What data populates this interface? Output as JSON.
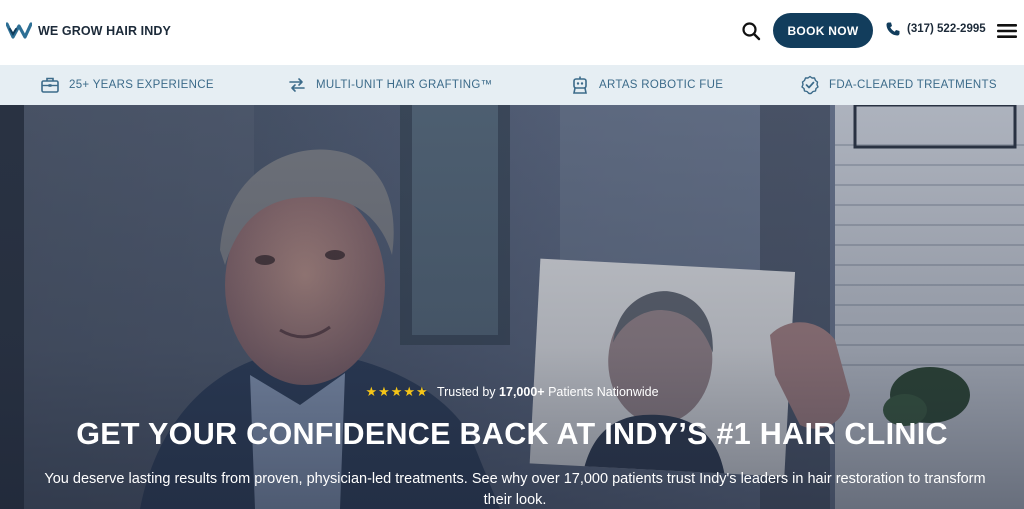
{
  "header": {
    "brand": "WE GROW HAIR INDY",
    "book_label": "BOOK NOW",
    "phone": "(317) 522-2995",
    "icons": [
      "logo-w-icon",
      "search-icon",
      "phone-icon",
      "menu-icon"
    ]
  },
  "features": [
    {
      "label": "25+ YEARS EXPERIENCE",
      "icon": "briefcase-icon"
    },
    {
      "label": "MULTI-UNIT HAIR GRAFTING™",
      "icon": "transfer-arrows-icon"
    },
    {
      "label": "ARTAS ROBOTIC FUE",
      "icon": "robot-icon"
    },
    {
      "label": "FDA-CLEARED TREATMENTS",
      "icon": "badge-check-icon"
    }
  ],
  "hero": {
    "stars": "★★★★★",
    "trusted_prefix": "Trusted by",
    "trusted_count": "17,000+",
    "trusted_suffix": "Patients Nationwide",
    "headline": "GET YOUR CONFIDENCE BACK AT INDY’S #1 HAIR CLINIC",
    "subtext": "You deserve lasting results from proven, physician-led treatments. See why over 17,000 patients trust Indy's leaders in hair restoration to transform their look."
  },
  "colors": {
    "primary": "#123d5c",
    "feature_text": "#3c6b8a",
    "feature_bg": "#e6eef3",
    "star": "#f5c518",
    "logo_accent": "#2d6f95"
  }
}
